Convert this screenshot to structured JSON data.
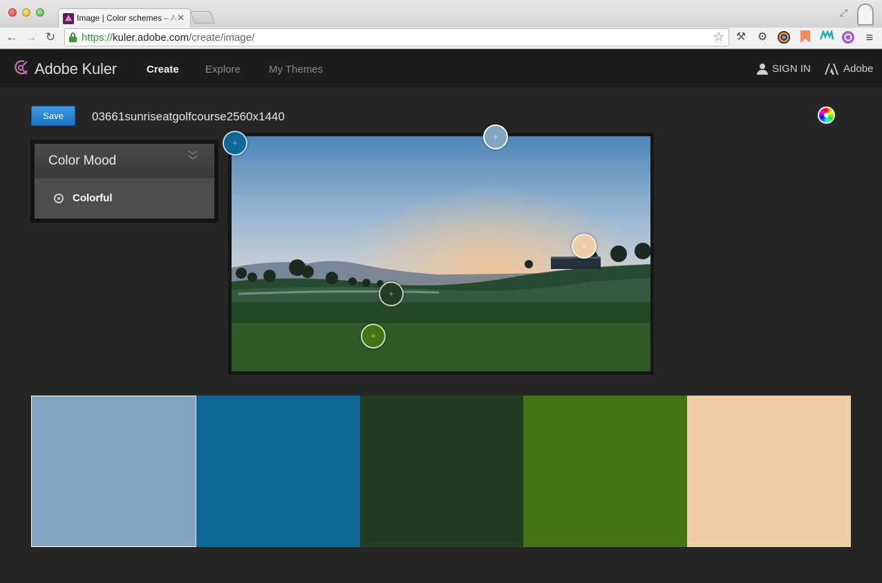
{
  "browser": {
    "tab_title": "Image | Color schemes – Adobe Kuler",
    "tab_close": "✕",
    "url_scheme": "https://",
    "url_host": "kuler.adobe.com",
    "url_path": "/create/image/"
  },
  "app": {
    "brand": "Adobe Kuler",
    "nav": [
      "Create",
      "Explore",
      "My Themes"
    ],
    "active_nav": "Create",
    "sign_in": "SIGN IN",
    "adobe": "Adobe"
  },
  "editor": {
    "save_label": "Save",
    "theme_name": "03661sunriseatgolfcourse2560x1440"
  },
  "mood": {
    "title": "Color Mood",
    "selected_option": "Colorful"
  },
  "swatches": [
    {
      "color": "#84a5c1"
    },
    {
      "color": "#0f6795"
    },
    {
      "color": "#213e23"
    },
    {
      "color": "#457312"
    },
    {
      "color": "#eecca4"
    }
  ],
  "selected_swatch": 0
}
